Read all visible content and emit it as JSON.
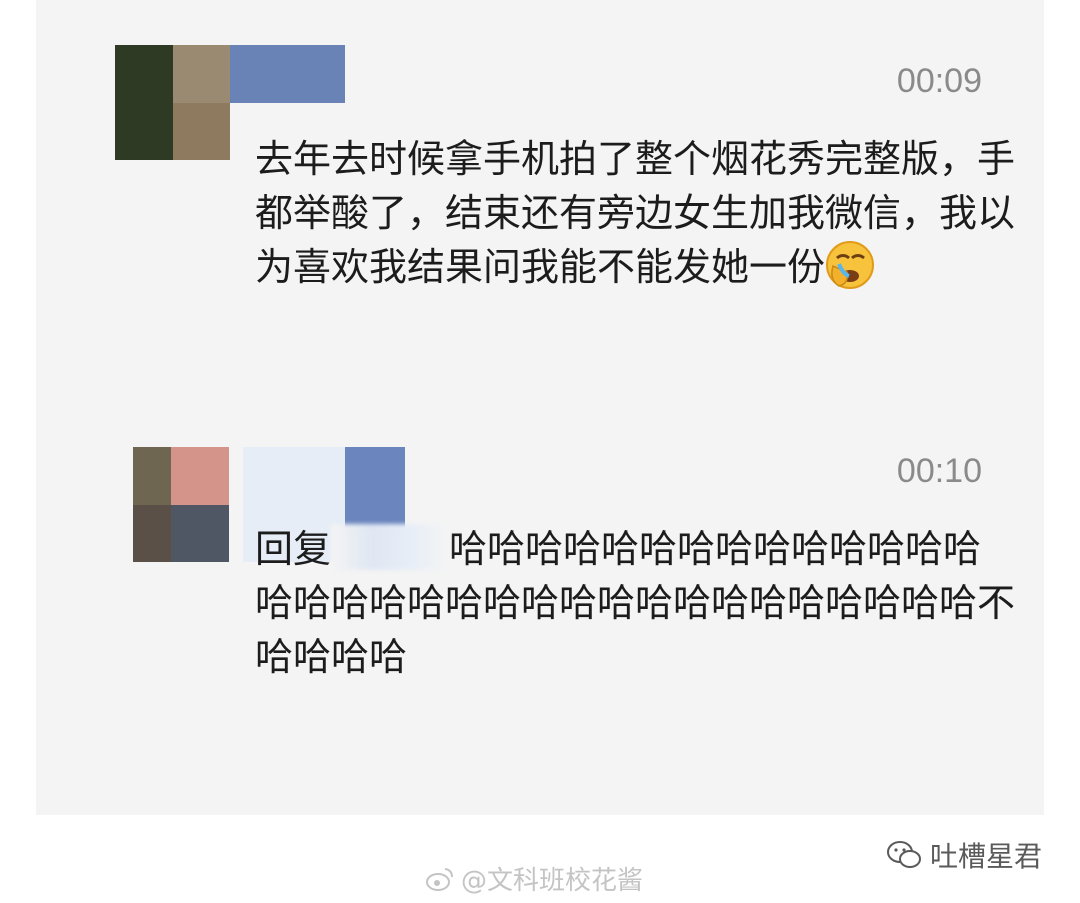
{
  "comments": [
    {
      "time": "00:09",
      "text": "去年去时候拿手机拍了整个烟花秀完整版，手都举酸了，结束还有旁边女生加我微信，我以为喜欢我结果问我能不能发她一份",
      "emoji": "face-holding-back-tears-icon"
    },
    {
      "time": "00:10",
      "reply_prefix": "回复",
      "text": "哈哈哈哈哈哈哈哈哈哈哈哈哈哈哈哈哈哈哈哈哈哈哈哈哈哈哈哈哈哈哈哈哈不哈哈哈哈"
    }
  ],
  "footer": {
    "watermark": "@文科班校花酱"
  },
  "badge": {
    "label": "吐槽星君"
  },
  "colors": {
    "panel": "#f4f4f4",
    "time": "#8a8a8a",
    "text": "#1c1c1c"
  }
}
